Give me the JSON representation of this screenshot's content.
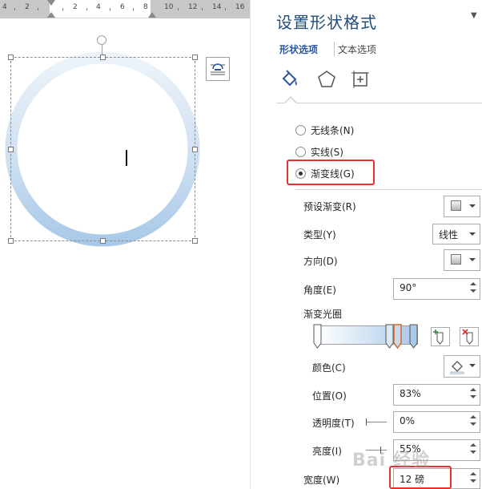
{
  "ruler": {
    "ticks": [
      "4",
      "2",
      "2",
      "4",
      "6",
      "8",
      "10",
      "12",
      "14",
      "16"
    ]
  },
  "pane": {
    "title": "设置形状格式",
    "tabs": [
      "形状选项",
      "文本选项"
    ],
    "icons": [
      "fill-line-icon",
      "effects-pentagon-icon",
      "size-properties-icon"
    ],
    "line_options": {
      "no_line": "无线条(N)",
      "solid_line": "实线(S)",
      "gradient_line": "渐变线(G)",
      "selected": "gradient_line"
    },
    "fields": {
      "preset_label": "预设渐变(R)",
      "type_label": "类型(Y)",
      "type_value": "线性",
      "direction_label": "方向(D)",
      "angle_label": "角度(E)",
      "angle_value": "90°",
      "stops_label": "渐变光圈",
      "color_label": "颜色(C)",
      "position_label": "位置(O)",
      "position_value": "83%",
      "transparency_label": "透明度(T)",
      "transparency_value": "0%",
      "brightness_label": "亮度(I)",
      "brightness_value": "55%",
      "width_label": "宽度(W)",
      "width_value": "12 磅"
    }
  },
  "watermark": "Bai 经验",
  "colors": {
    "accent_blue": "#2b579a",
    "highlight_red": "#e8312e",
    "ring_light": "#e3edf8",
    "ring_dark": "#b3cfe9"
  }
}
